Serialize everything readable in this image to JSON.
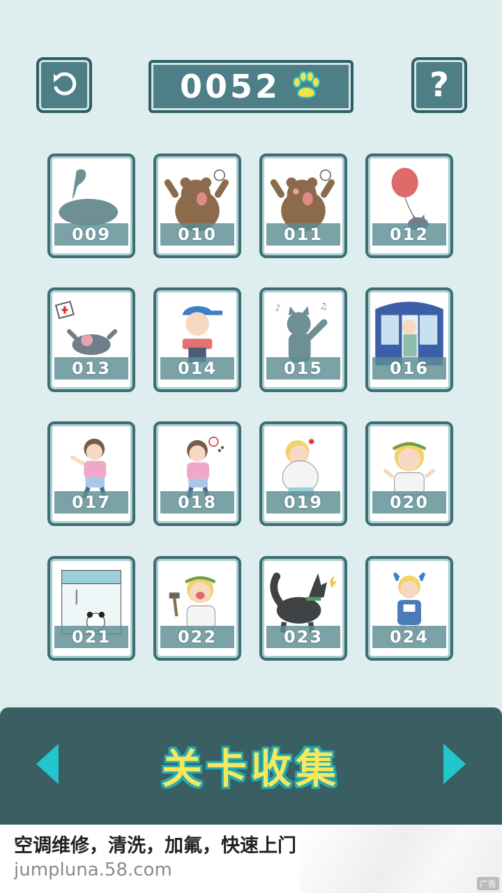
{
  "header": {
    "score": "0052",
    "help_label": "?",
    "back_icon": "undo-arrow-icon",
    "score_icon": "paw-icon"
  },
  "cards": [
    {
      "id": "009",
      "state": "locked",
      "icon": "ghost-silhouette"
    },
    {
      "id": "010",
      "state": "unlocked",
      "icon": "angry-bear"
    },
    {
      "id": "011",
      "state": "unlocked",
      "icon": "angry-bear-blush"
    },
    {
      "id": "012",
      "state": "unlocked",
      "icon": "cat-with-balloon"
    },
    {
      "id": "013",
      "state": "unlocked",
      "icon": "angry-cat-lying"
    },
    {
      "id": "014",
      "state": "unlocked",
      "icon": "boy-with-cap"
    },
    {
      "id": "015",
      "state": "locked",
      "icon": "singing-cat-silhouette"
    },
    {
      "id": "016",
      "state": "unlocked",
      "icon": "train-door"
    },
    {
      "id": "017",
      "state": "unlocked",
      "icon": "girl-pink-shirt"
    },
    {
      "id": "018",
      "state": "unlocked",
      "icon": "girl-pink-shirt-angry"
    },
    {
      "id": "019",
      "state": "unlocked",
      "icon": "blond-big-guy"
    },
    {
      "id": "020",
      "state": "unlocked",
      "icon": "blond-wreath-guy"
    },
    {
      "id": "021",
      "state": "unlocked",
      "icon": "panda-claw-machine"
    },
    {
      "id": "022",
      "state": "unlocked",
      "icon": "angry-guy-hammer"
    },
    {
      "id": "023",
      "state": "unlocked",
      "icon": "barking-husky"
    },
    {
      "id": "024",
      "state": "unlocked",
      "icon": "blond-kid-overalls"
    }
  ],
  "footer": {
    "title": "关卡收集",
    "prev_icon": "arrow-left-icon",
    "next_icon": "arrow-right-icon"
  },
  "ad": {
    "title": "空调维修，清洗，加氟，快速上门",
    "url": "jumpluna.58.com",
    "tag": "广告"
  },
  "colors": {
    "background": "#deeeee",
    "frame": "#3f6d74",
    "accent": "#25c4c9",
    "title_yellow": "#f7e75c"
  }
}
